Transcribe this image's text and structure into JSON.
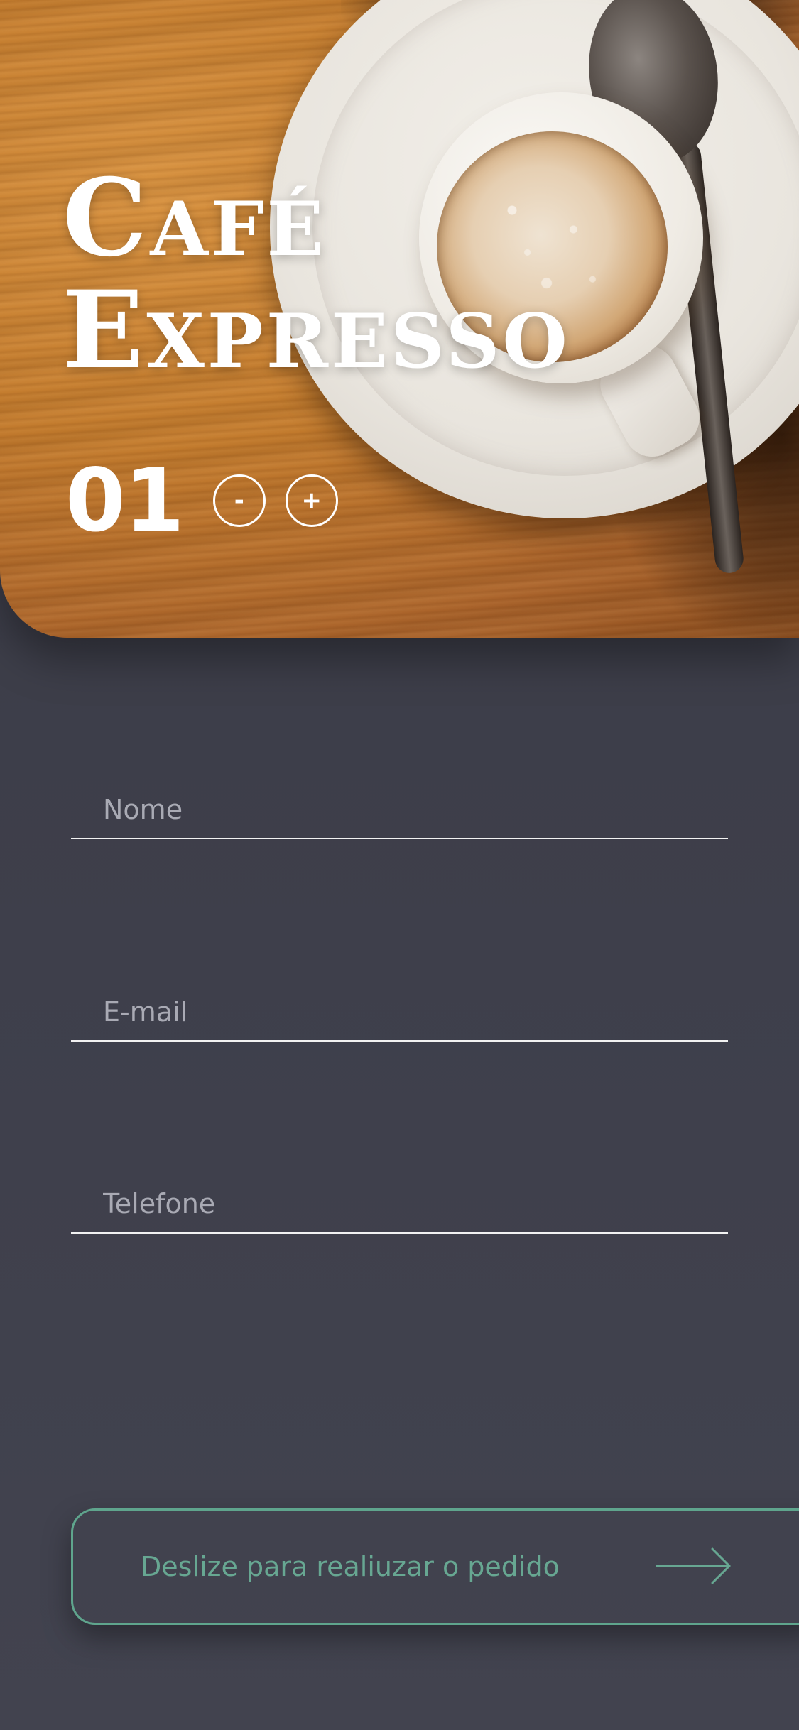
{
  "product": {
    "title_line1": "Café",
    "title_line2": "Expresso",
    "quantity": "01",
    "decrement_label": "-",
    "increment_label": "+"
  },
  "form": {
    "name_placeholder": "Nome",
    "email_placeholder": "E-mail",
    "phone_placeholder": "Telefone"
  },
  "cta": {
    "label": "Deslize para realiuzar o pedido",
    "icon": "arrow-right-icon"
  },
  "colors": {
    "background": "#3c3d47",
    "accent": "#5fa58d",
    "text": "#ffffff",
    "placeholder": "#a9aab4"
  }
}
